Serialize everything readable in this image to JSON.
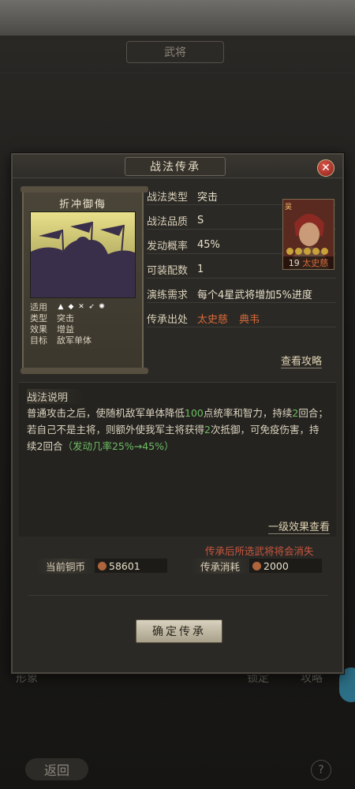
{
  "background": {
    "page_title": "武将",
    "footer_left": "形象",
    "footer_lock": "锁定",
    "footer_attack": "攻略",
    "back_label": "返回",
    "help_label": "?"
  },
  "dialog": {
    "title": "战法传承",
    "close_label": "✕"
  },
  "card": {
    "name": "折冲御侮",
    "stats": [
      {
        "label": "适用",
        "value": ""
      },
      {
        "label": "类型",
        "value": "突击"
      },
      {
        "label": "效果",
        "value": "增益"
      },
      {
        "label": "目标",
        "value": "敌军单体"
      }
    ]
  },
  "info": {
    "type_label": "战法类型",
    "type_value": "突击",
    "quality_label": "战法品质",
    "quality_value": "S",
    "prob_label": "发动概率",
    "prob_value": "45%",
    "equip_label": "可装配数",
    "equip_value": "1",
    "train_label": "演练需求",
    "train_value": "每个4星武将增加5%进度",
    "source_label": "传承出处",
    "source_1": "太史慈",
    "source_2": "典韦"
  },
  "general": {
    "faction": "吴",
    "level": "19",
    "name": "太史慈"
  },
  "guide_link": "查看攻略",
  "description": {
    "title": "战法说明",
    "part1": "普通攻击之后，使随机敌军单体降低",
    "num1": "100",
    "part2": "点统率和智力，持续",
    "num2": "2",
    "part3": "回合；若自己不是主将，则额外使我军主将获得",
    "num3": "2",
    "part4": "次抵御，可免疫伤害，持续2回合",
    "extra": "（发动几率25%→45%）",
    "level_effect": "一级效果查看"
  },
  "warning": "传承后所选武将将会消失",
  "cost": {
    "copper_label": "当前铜币",
    "copper_value": "58601",
    "consume_label": "传承消耗",
    "consume_value": "2000"
  },
  "confirm_label": "确定传承"
}
